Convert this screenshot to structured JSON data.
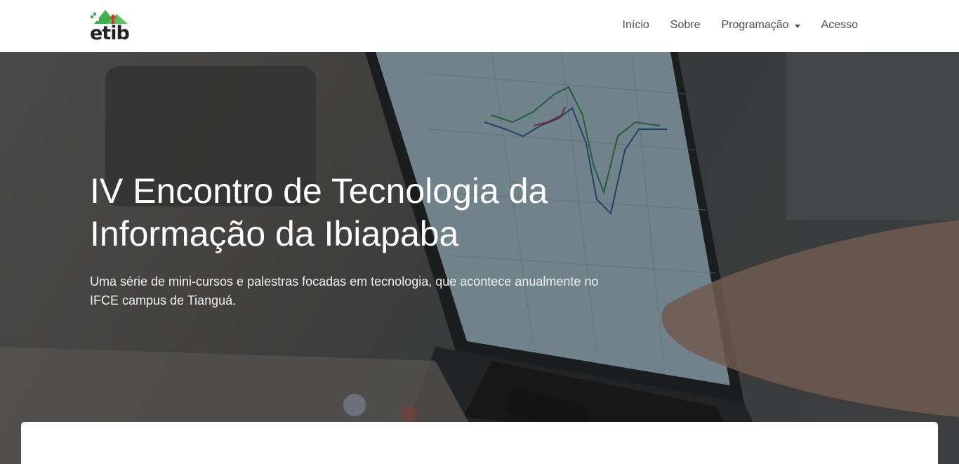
{
  "brand": {
    "name": "etib",
    "colors": {
      "green": "#3cb44a",
      "red": "#d9342b",
      "dark": "#222222"
    }
  },
  "nav": {
    "items": [
      {
        "label": "Início"
      },
      {
        "label": "Sobre"
      },
      {
        "label": "Programação",
        "dropdown": true
      },
      {
        "label": "Acesso"
      }
    ]
  },
  "hero": {
    "title": "IV Encontro de Tecnologia da Informação da Ibiapaba",
    "subtitle": "Uma série de mini-cursos e palestras focadas em tecnologia, que acontece anualmente no IFCE campus de Tianguá."
  }
}
